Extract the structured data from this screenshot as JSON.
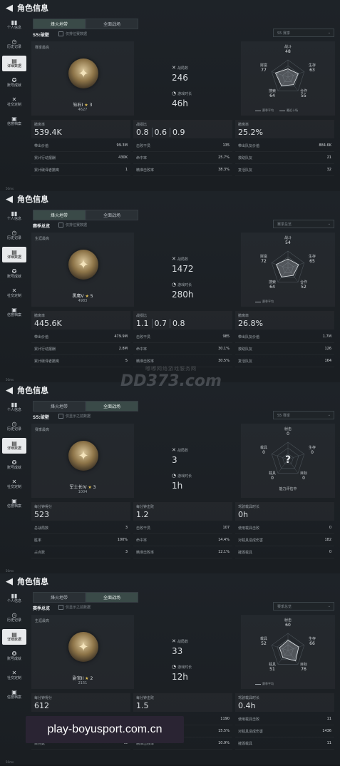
{
  "header_title": "角色信息",
  "sidebar_items": [
    {
      "label": "个人信息",
      "icon": "bar-chart-icon"
    },
    {
      "label": "历史记录",
      "icon": "history-icon"
    },
    {
      "label": "详细数据",
      "icon": "detail-data-icon"
    },
    {
      "label": "账号成就",
      "icon": "achievement-icon"
    },
    {
      "label": "社交定制",
      "icon": "social-icon"
    },
    {
      "label": "信誉档案",
      "icon": "credit-icon"
    }
  ],
  "tabs": [
    "烽火地带",
    "全面战场"
  ],
  "panels": [
    {
      "active_tab": 0,
      "season": "S5:破壁",
      "filter": "仅排位赛数据",
      "select": "S5 赛季",
      "card_label": "赛季最高",
      "rank_name": "钻石I",
      "rank_stars": "3",
      "rank_score": "4627",
      "mid_stats": [
        {
          "label": "战局数",
          "value": "246"
        },
        {
          "label": "游戏时长",
          "value": "46h"
        }
      ],
      "radar_labels": {
        "top": "战斗",
        "right": "生存",
        "bright": "合作",
        "bleft": "搜索",
        "left": "财富"
      },
      "radar_values": {
        "top": "48",
        "right": "63",
        "bright": "55",
        "bleft": "64",
        "left": "77"
      },
      "legend": [
        "赛季平均",
        "最近十场"
      ],
      "col1": {
        "label": "撤离率",
        "value": [
          "539.4K"
        ],
        "rows": [
          [
            "带出价值",
            "99.3M"
          ],
          [
            "累计行动报酬",
            "430K"
          ],
          [
            "累计破译者撤离",
            "1"
          ]
        ]
      },
      "col2": {
        "label": "战损比",
        "value": [
          "0.8",
          "0.6",
          "0.9"
        ],
        "rows": [
          [
            "击败干员",
            "135"
          ],
          [
            "命中率",
            "25.7%"
          ],
          [
            "精准击败率",
            "38.3%"
          ]
        ]
      },
      "col3": {
        "label": "撤离率",
        "value": [
          "25.2%"
        ],
        "rows": [
          [
            "带出队友价值",
            "884.6K"
          ],
          [
            "救助队友",
            "21"
          ],
          [
            "复活队友",
            "32"
          ]
        ]
      },
      "status": "50ms"
    },
    {
      "active_tab": 0,
      "season": "赛季总览",
      "filter": "仅排位赛数据",
      "select": "赛季总览",
      "card_label": "生涯最高",
      "rank_name": "黑鹰V",
      "rank_stars": "5",
      "rank_score": "4983",
      "mid_stats": [
        {
          "label": "战局数",
          "value": "1472"
        },
        {
          "label": "游戏时长",
          "value": "280h"
        }
      ],
      "radar_labels": {
        "top": "战斗",
        "right": "生存",
        "bright": "合作",
        "bleft": "搜索",
        "left": "财富"
      },
      "radar_values": {
        "top": "54",
        "right": "65",
        "bright": "52",
        "bleft": "64",
        "left": "72"
      },
      "legend": [
        "赛季平均"
      ],
      "col1": {
        "label": "撤离率",
        "value": [
          "445.6K"
        ],
        "rows": [
          [
            "带出价值",
            "479.9M"
          ],
          [
            "累计行动报酬",
            "2.8M"
          ],
          [
            "累计破译者撤离",
            "5"
          ]
        ]
      },
      "col2": {
        "label": "战损比",
        "value": [
          "1.1",
          "0.7",
          "0.8"
        ],
        "rows": [
          [
            "击败干员",
            "985"
          ],
          [
            "命中率",
            "30.1%"
          ],
          [
            "精准击败率",
            "30.5%"
          ]
        ]
      },
      "col3": {
        "label": "撤离率",
        "value": [
          "26.8%"
        ],
        "rows": [
          [
            "带出队友价值",
            "1.7M"
          ],
          [
            "救助队友",
            "126"
          ],
          [
            "复活队友",
            "164"
          ]
        ]
      },
      "status": "50ms"
    },
    {
      "active_tab": 1,
      "season": "S5:破壁",
      "filter": "仅显示之前数据",
      "select": "S5 赛季",
      "card_label": "赛季最高",
      "rank_name": "军士长IV",
      "rank_stars": "3",
      "rank_score": "1004",
      "mid_stats": [
        {
          "label": "战局数",
          "value": "3"
        },
        {
          "label": "游戏时长",
          "value": "1h"
        }
      ],
      "radar_labels": {
        "top": "射击",
        "right": "生存",
        "bright": "目标",
        "bleft": "载具",
        "left": "载具"
      },
      "radar_values": {
        "top": "0",
        "right": "0",
        "bright": "0",
        "bleft": "0",
        "left": "0"
      },
      "radar_note": "能力评估中",
      "legend": [],
      "col1": {
        "label": "每分钟得分",
        "value": [
          "523"
        ],
        "rows": [
          [
            "总战局数",
            "3"
          ],
          [
            "胜率",
            "100%"
          ],
          [
            "占点数",
            "3"
          ]
        ]
      },
      "col2": {
        "label": "每分钟击败",
        "value": [
          "1.2"
        ],
        "rows": [
          [
            "击败干员",
            "107"
          ],
          [
            "命中率",
            "14.4%"
          ],
          [
            "精准击败率",
            "12.1%"
          ]
        ]
      },
      "col3": {
        "label": "驾驶载具时长",
        "value": [
          "0h"
        ],
        "rows": [
          [
            "使用载具击败",
            "0"
          ],
          [
            "对载具造成伤害",
            "182"
          ],
          [
            "摧毁载具",
            "0"
          ]
        ]
      },
      "status": "50ms"
    },
    {
      "active_tab": 1,
      "season": "赛季总览",
      "filter": "仅显示之前数据",
      "select": "赛季总览",
      "card_label": "生涯最高",
      "rank_name": "尉官II",
      "rank_stars": "2",
      "rank_score": "2151",
      "mid_stats": [
        {
          "label": "战局数",
          "value": "33"
        },
        {
          "label": "游戏时长",
          "value": "12h"
        }
      ],
      "radar_labels": {
        "top": "射击",
        "right": "生存",
        "bright": "目标",
        "bleft": "载具",
        "left": "载具"
      },
      "radar_values": {
        "top": "60",
        "right": "66",
        "bright": "76",
        "bleft": "51",
        "left": "52"
      },
      "legend": [
        "赛季平均"
      ],
      "col1": {
        "label": "每分钟得分",
        "value": [
          "612"
        ],
        "rows": [
          [
            "总战局数",
            ""
          ],
          [
            "胜率",
            ""
          ],
          [
            "占点数",
            "48"
          ]
        ]
      },
      "col2": {
        "label": "每分钟击败",
        "value": [
          "1.5"
        ],
        "rows": [
          [
            "击败干员",
            "1190"
          ],
          [
            "命中率",
            "15.5%"
          ],
          [
            "精准击败率",
            "10.9%"
          ]
        ]
      },
      "col3": {
        "label": "驾驶载具时长",
        "value": [
          "0.4h"
        ],
        "rows": [
          [
            "使用载具击败",
            "11"
          ],
          [
            "对载具造成伤害",
            "1436"
          ],
          [
            "摧毁载具",
            "11"
          ]
        ]
      },
      "status": "50ms"
    }
  ],
  "watermark": {
    "sub": "嘟嘟网络游戏服务网",
    "main": "DD373.com"
  },
  "banner_text": "play-boyusport.com.cn"
}
